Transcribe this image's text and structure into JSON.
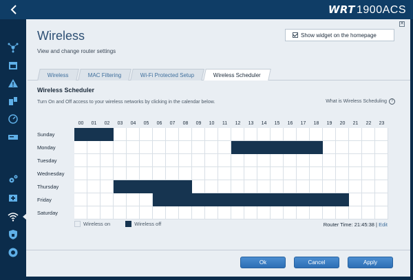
{
  "brand": {
    "prefix": "WRT",
    "model": "1900ACS"
  },
  "header": {
    "title": "Wireless",
    "subtitle": "View and change router settings",
    "widget_label": "Show widget on the homepage",
    "widget_checked": true
  },
  "tabs": [
    {
      "label": "Wireless"
    },
    {
      "label": "MAC Filtering"
    },
    {
      "label": "Wi-Fi Protected Setup"
    },
    {
      "label": "Wireless Scheduler",
      "active": true
    }
  ],
  "scheduler": {
    "title": "Wireless Scheduler",
    "description": "Turn On and Off access to your wireless networks by clicking in the calendar below.",
    "help_link": "What is Wireless Scheduling",
    "hours": [
      "00",
      "01",
      "02",
      "03",
      "04",
      "05",
      "06",
      "07",
      "08",
      "09",
      "10",
      "11",
      "12",
      "13",
      "14",
      "15",
      "16",
      "17",
      "18",
      "19",
      "20",
      "21",
      "22",
      "23"
    ],
    "days": [
      {
        "name": "Sunday",
        "off_hours": [
          0,
          1,
          2
        ]
      },
      {
        "name": "Monday",
        "off_hours": [
          12,
          13,
          14,
          15,
          16,
          17,
          18
        ]
      },
      {
        "name": "Tuesday",
        "off_hours": []
      },
      {
        "name": "Wednesday",
        "off_hours": []
      },
      {
        "name": "Thursday",
        "off_hours": [
          3,
          4,
          5,
          6,
          7,
          8
        ]
      },
      {
        "name": "Friday",
        "off_hours": [
          6,
          7,
          8,
          9,
          10,
          11,
          12,
          13,
          14,
          15,
          16,
          17,
          18,
          19,
          20
        ]
      },
      {
        "name": "Saturday",
        "off_hours": []
      }
    ],
    "legend_on": "Wireless on",
    "legend_off": "Wireless off",
    "router_time_label": "Router Time: 21:45:38",
    "edit_label": "Edit"
  },
  "buttons": {
    "ok": "Ok",
    "cancel": "Cancel",
    "apply": "Apply"
  },
  "colors": {
    "off": "#163450",
    "accent": "#2d6fb5"
  }
}
